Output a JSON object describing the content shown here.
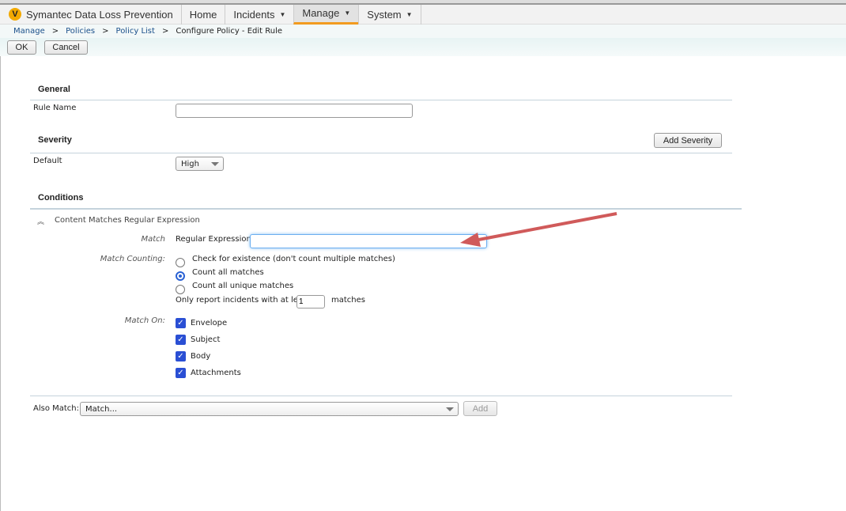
{
  "app": {
    "title": "Symantec Data Loss Prevention",
    "logo_letter": "V"
  },
  "nav": {
    "items": [
      {
        "label": "Home"
      },
      {
        "label": "Incidents"
      },
      {
        "label": "Manage"
      },
      {
        "label": "System"
      }
    ]
  },
  "breadcrumb": {
    "items": [
      "Manage",
      "Policies",
      "Policy List"
    ],
    "current": "Configure Policy - Edit Rule",
    "sep": ">"
  },
  "toolbar": {
    "ok": "OK",
    "cancel": "Cancel"
  },
  "general": {
    "title": "General",
    "rule_name_label": "Rule Name",
    "rule_name_value": ""
  },
  "severity": {
    "title": "Severity",
    "add_button": "Add Severity",
    "default_label": "Default",
    "default_value": "High"
  },
  "conditions": {
    "title": "Conditions",
    "condition_title": "Content Matches Regular Expression",
    "match_label": "Match",
    "regex_label": "Regular Expression:",
    "regex_value": "",
    "counting_label": "Match Counting:",
    "counting_options": [
      "Check for existence (don't count multiple matches)",
      "Count all matches",
      "Count all unique matches"
    ],
    "selected_counting": 1,
    "min_prefix": "Only report incidents with at least",
    "min_value": "1",
    "min_suffix": "matches",
    "match_on_label": "Match On:",
    "match_on": [
      {
        "label": "Envelope",
        "checked": true
      },
      {
        "label": "Subject",
        "checked": true
      },
      {
        "label": "Body",
        "checked": true
      },
      {
        "label": "Attachments",
        "checked": true
      }
    ]
  },
  "also_match": {
    "label": "Also Match:",
    "value": "Match...",
    "add": "Add"
  },
  "annotation": {
    "arrow_color": "#d05a5a"
  }
}
